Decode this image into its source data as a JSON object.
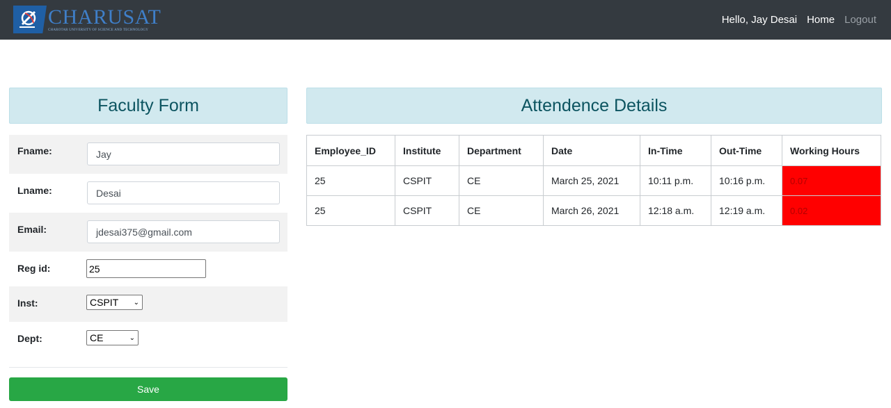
{
  "navbar": {
    "logo": {
      "title": "CHARUSAT",
      "subtitle": "CHAROTAR UNIVERSITY OF SCIENCE AND TECHNOLOGY",
      "emblem_icon": "university-emblem-icon"
    },
    "greeting": "Hello, Jay Desai",
    "home": "Home",
    "logout": "Logout"
  },
  "faculty_form": {
    "title": "Faculty Form",
    "fields": {
      "fname": {
        "label": "Fname:",
        "value": "Jay"
      },
      "lname": {
        "label": "Lname:",
        "value": "Desai"
      },
      "email": {
        "label": "Email:",
        "value": "jdesai375@gmail.com"
      },
      "reg_id": {
        "label": "Reg id:",
        "value": "25"
      },
      "inst": {
        "label": "Inst:",
        "value": "CSPIT"
      },
      "dept": {
        "label": "Dept:",
        "value": "CE"
      }
    },
    "save_label": "Save"
  },
  "attendance": {
    "title": "Attendence Details",
    "columns": [
      "Employee_ID",
      "Institute",
      "Department",
      "Date",
      "In-Time",
      "Out-Time",
      "Working Hours"
    ],
    "rows": [
      [
        "25",
        "CSPIT",
        "CE",
        "March 25, 2021",
        "10:11 p.m.",
        "10:16 p.m.",
        "0.07"
      ],
      [
        "25",
        "CSPIT",
        "CE",
        "March 26, 2021",
        "12:18 a.m.",
        "12:19 a.m.",
        "0.02"
      ]
    ],
    "highlight_color": "#ff0000"
  },
  "colors": {
    "navbar_bg": "#343a40",
    "panel_header_bg": "#d1e9ef",
    "panel_header_text": "#0c5460",
    "save_button": "#28a745"
  }
}
